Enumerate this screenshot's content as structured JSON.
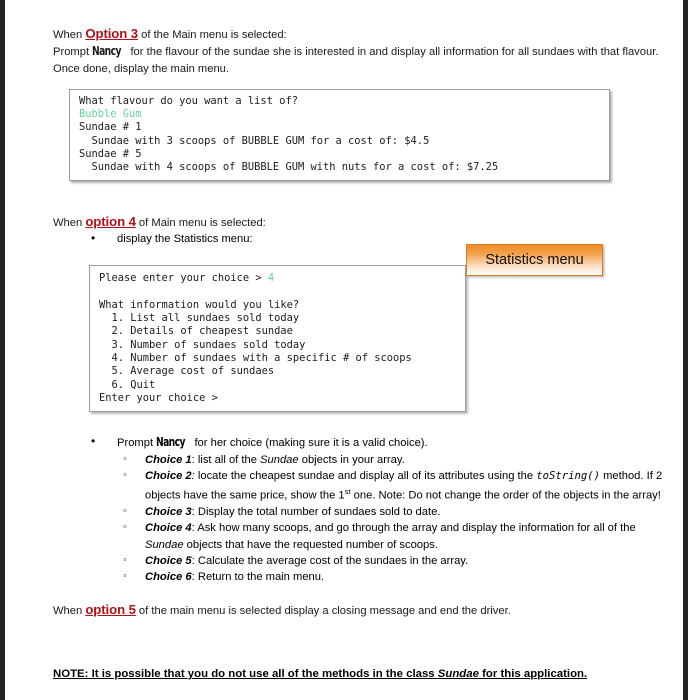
{
  "document": {
    "option3": {
      "when_prefix": "When ",
      "label": "Option 3",
      "when_suffix": " of the Main menu is selected:",
      "prompt_prefix": "Prompt ",
      "person": "Nancy",
      "prompt_suffix": " for the flavour of the sundae she is interested in and display all  information for all sundaes with that flavour.  Once done, display the main menu."
    },
    "console_flavour": {
      "line1": "What flavour do you want a list of?",
      "input_value": "Bubble Gum",
      "line3": "Sundae # 1",
      "line4": "  Sundae with 3 scoops of BUBBLE GUM for a cost of: $4.5",
      "line5": "Sundae # 5",
      "line6": "  Sundae with 4 scoops of BUBBLE GUM with nuts for a cost of: $7.25",
      "input_color": "#5FD39B"
    },
    "option4": {
      "when_prefix": "When ",
      "label": "option 4",
      "when_suffix": " of Main menu is selected:",
      "bullet": "display the Statistics menu:"
    },
    "callout": {
      "label": "Statistics menu",
      "accent_color": "#EE8C26"
    },
    "console_stats": {
      "line1_pre": "Please enter your choice > ",
      "line1_val": "4",
      "line2": "",
      "line3": "What information would you like?",
      "line4": "  1. List all sundaes sold today",
      "line5": "  2. Details of cheapest sundae",
      "line6": "  3. Number of sundaes sold today",
      "line7": "  4. Number of sundaes with a specific # of scoops",
      "line8": "  5. Average cost of sundaes",
      "line9": "  6. Quit",
      "line10": "Enter your choice >"
    },
    "choices": {
      "prompt_prefix": "Prompt ",
      "prompt_person": "Nancy",
      "prompt_suffix": " for her choice (making sure it is a valid choice).",
      "items": [
        {
          "name": "Choice 1",
          "sep": ": ",
          "text_a": "list all of the ",
          "emph": "Sundae",
          "text_b": " objects in your array."
        },
        {
          "name": "Choice 2",
          "sep": ": ",
          "text_a": "locate the cheapest sundae and display all of its attributes using the ",
          "code": "toString()",
          "text_b": " method. If 2 objects have the same price, show the 1",
          "sup": "st",
          "text_c": " one. Note: Do not change the order of the objects in the array!"
        },
        {
          "name": "Choice 3",
          "sep": ": ",
          "text_a": "Display the total number of sundaes sold to date."
        },
        {
          "name": "Choice 4",
          "sep": ": ",
          "text_a": "Ask how many scoops, and go through the array and display the information for all of the ",
          "emph": "Sundae",
          "text_b": " objects that have the requested number of scoops."
        },
        {
          "name": "Choice 5",
          "sep": ": ",
          "text_a": "Calculate the average cost of the sundaes in the array."
        },
        {
          "name": "Choice 6",
          "sep": ": ",
          "text_a": "Return to the main menu."
        }
      ]
    },
    "option5": {
      "when_prefix": "When ",
      "label": "option 5",
      "when_suffix": " of the main menu is selected display a closing message and end the driver."
    },
    "note": {
      "text_a": "NOTE: It is possible that you do not use all of the methods in the class ",
      "emph": "Sundae",
      "text_b": " for this application."
    }
  }
}
